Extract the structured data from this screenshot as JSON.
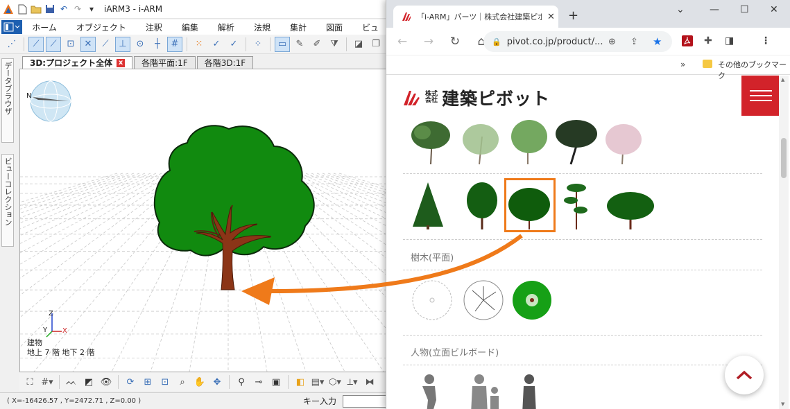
{
  "cad": {
    "title": "iARM3 - i-ARM",
    "menu": [
      "ホーム",
      "オブジェクト",
      "注釈",
      "編集",
      "解析",
      "法規",
      "集計",
      "図面",
      "ビュ"
    ],
    "side_tabs": [
      "データブラウザ",
      "ビューコレクション"
    ],
    "doc_tabs": [
      "3D:プロジェクト全体",
      "各階平面:1F",
      "各階3D:1F"
    ],
    "active_tab_close": "x",
    "compass_label": "N",
    "axis": {
      "z": "Z",
      "y": "Y",
      "x": "X"
    },
    "building_info": [
      "建物",
      "地上 7 階  地下 2 階"
    ],
    "status_coords": "( X=-16426.57 , Y=2472.71 , Z=0.00 )",
    "key_input_label": "キー入力"
  },
  "browser": {
    "tab_title": "「i-ARM」パーツ｜株式会社建築ピボット",
    "url": "pivot.co.jp/product/...",
    "bookmarks_more": "»",
    "bookmark_folder": "その他のブックマーク",
    "logo_small_top": "株式",
    "logo_small_bottom": "会社",
    "logo_name": "建築ピボット",
    "sections": [
      "樹木(平面)",
      "人物(立面ビルボード)"
    ],
    "colors": {
      "brand_red": "#d2232a",
      "highlight_orange": "#ef7a1a",
      "tree_green": "#118a0f",
      "trunk_brown": "#8b3517"
    }
  }
}
